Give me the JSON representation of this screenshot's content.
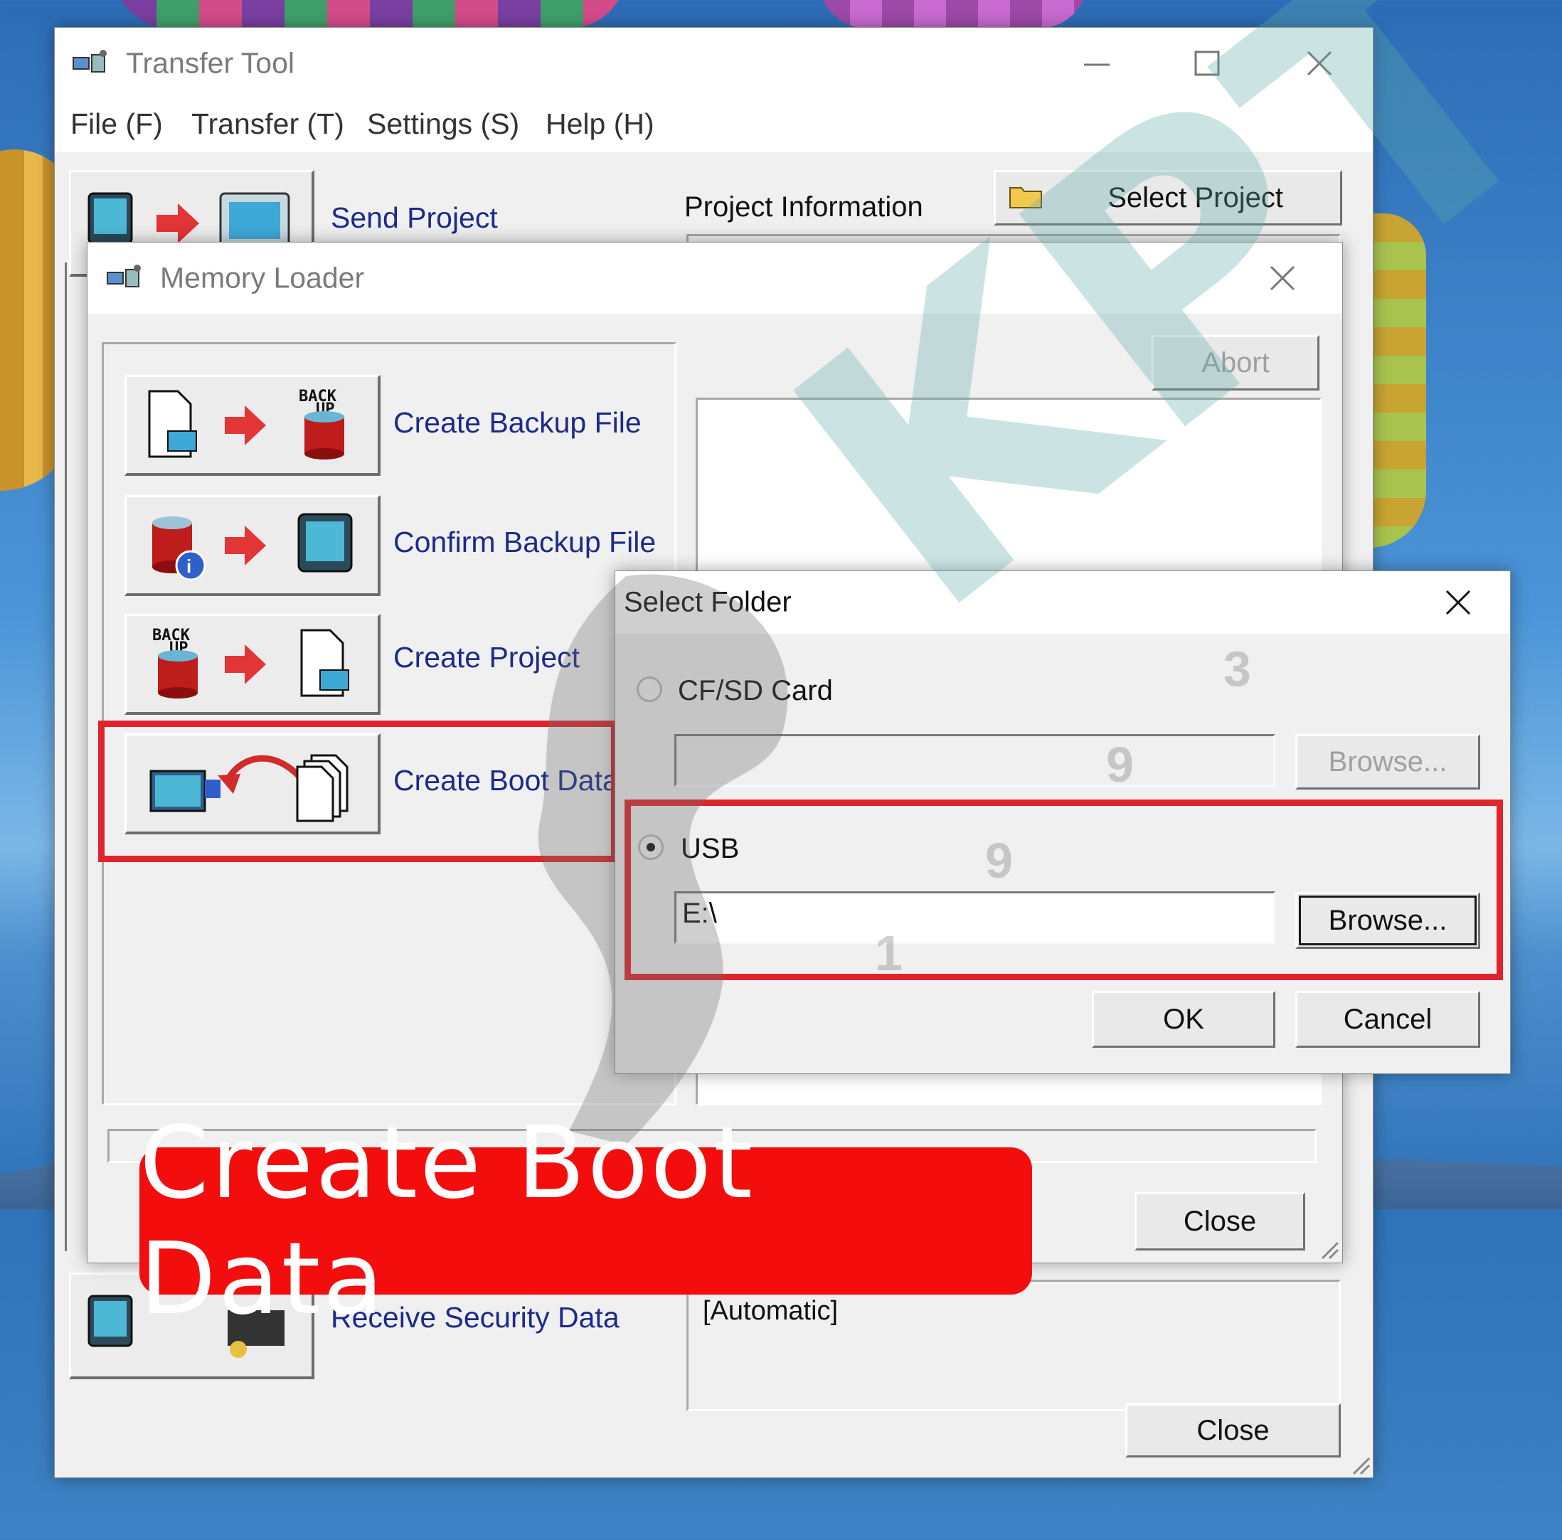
{
  "transfer_tool": {
    "title": "Transfer Tool",
    "menu": [
      "File (F)",
      "Transfer (T)",
      "Settings (S)",
      "Help (H)"
    ],
    "send_project_label": "Send Project",
    "project_info_label": "Project Information",
    "select_project_label": "Select Project",
    "receive_security_label": "Receive Security Data",
    "automatic_text": "[Automatic]",
    "close_label": "Close"
  },
  "memory_loader": {
    "title": "Memory Loader",
    "abort_label": "Abort",
    "items": [
      {
        "label": "Create Backup File"
      },
      {
        "label": "Confirm Backup File"
      },
      {
        "label": "Create Project"
      },
      {
        "label": "Create Boot Data"
      }
    ],
    "close_label": "Close"
  },
  "select_folder": {
    "title": "Select Folder",
    "cf_sd_label": "CF/SD Card",
    "cf_sd_path": "",
    "usb_label": "USB",
    "usb_path": "E:\\",
    "browse_label": "Browse...",
    "ok_label": "OK",
    "cancel_label": "Cancel",
    "selected_option": "USB"
  },
  "banner": {
    "text": "Create Boot Data"
  },
  "watermark": {
    "text": "KPT",
    "digits": [
      "3",
      "9",
      "9",
      "1"
    ]
  },
  "colors": {
    "highlight_red": "#e0242c",
    "banner_red": "#f40d0d",
    "link_blue": "#1c2a8a"
  }
}
